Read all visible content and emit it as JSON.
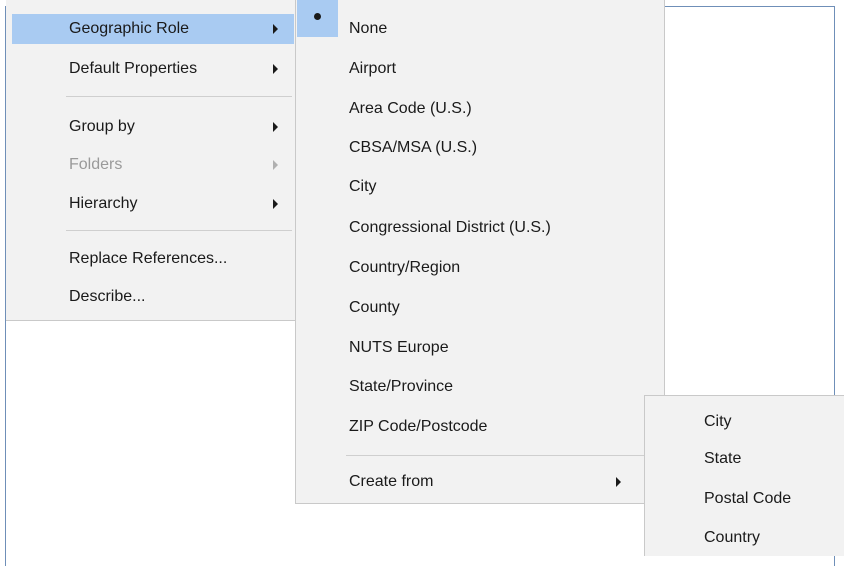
{
  "main_menu": {
    "items": [
      {
        "label": "Geographic Role"
      },
      {
        "label": "Default Properties"
      },
      {
        "label": "Group by"
      },
      {
        "label": "Folders"
      },
      {
        "label": "Hierarchy"
      },
      {
        "label": "Replace References..."
      },
      {
        "label": "Describe..."
      }
    ]
  },
  "geo_menu": {
    "items": [
      {
        "label": "None"
      },
      {
        "label": "Airport"
      },
      {
        "label": "Area Code (U.S.)"
      },
      {
        "label": "CBSA/MSA (U.S.)"
      },
      {
        "label": "City"
      },
      {
        "label": "Congressional District (U.S.)"
      },
      {
        "label": "Country/Region"
      },
      {
        "label": "County"
      },
      {
        "label": "NUTS Europe"
      },
      {
        "label": "State/Province"
      },
      {
        "label": "ZIP Code/Postcode"
      },
      {
        "label": "Create from"
      }
    ]
  },
  "create_from_menu": {
    "items": [
      {
        "label": "City"
      },
      {
        "label": "State"
      },
      {
        "label": "Postal Code"
      },
      {
        "label": "Country"
      }
    ]
  },
  "colors": {
    "highlight": "#a9cbf2",
    "menu_background": "#f2f2f2",
    "disabled_text": "#9a9a9a",
    "frame_border": "#6f8fb8"
  },
  "icons": {
    "checked": "bullet-icon",
    "submenu": "chevron-right-icon"
  }
}
